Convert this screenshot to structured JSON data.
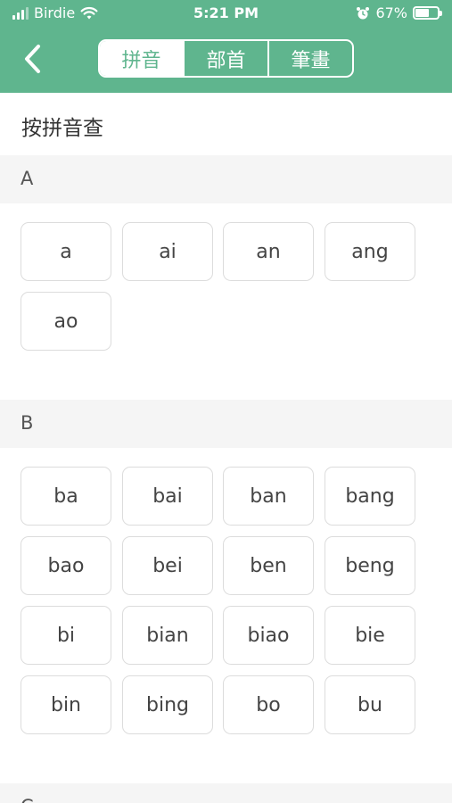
{
  "status_bar": {
    "carrier": "Birdie",
    "time": "5:21 PM",
    "battery_percent": "67%",
    "battery_level": 0.67,
    "icons": [
      "signal-icon",
      "wifi-icon",
      "alarm-icon",
      "battery-icon"
    ]
  },
  "nav": {
    "back_icon": "chevron-left-icon",
    "tabs": [
      {
        "label": "拼音",
        "active": true
      },
      {
        "label": "部首",
        "active": false
      },
      {
        "label": "筆畫",
        "active": false
      }
    ]
  },
  "page_title": "按拼音查",
  "sections": [
    {
      "letter": "A",
      "items": [
        "a",
        "ai",
        "an",
        "ang",
        "ao"
      ]
    },
    {
      "letter": "B",
      "items": [
        "ba",
        "bai",
        "ban",
        "bang",
        "bao",
        "bei",
        "ben",
        "beng",
        "bi",
        "bian",
        "biao",
        "bie",
        "bin",
        "bing",
        "bo",
        "bu"
      ]
    },
    {
      "letter": "C",
      "items": []
    }
  ],
  "colors": {
    "accent": "#5fb58e",
    "section_bg": "#f5f5f5",
    "pill_border": "#dcdcdc"
  }
}
